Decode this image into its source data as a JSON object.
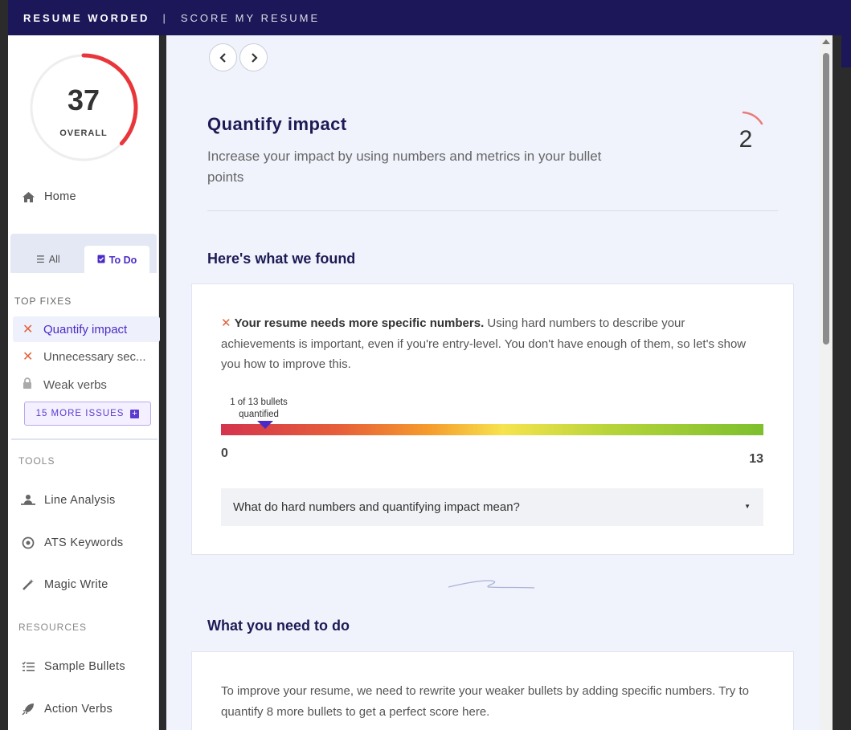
{
  "topbar": {
    "brand": "RESUME WORDED",
    "separator": "|",
    "subtitle": "SCORE MY RESUME"
  },
  "sidebar": {
    "score": {
      "value": "37",
      "label": "OVERALL",
      "fraction": 0.37,
      "arc_color": "#e8363a"
    },
    "home": "Home",
    "tabs": [
      {
        "label": "All",
        "icon": "list-icon"
      },
      {
        "label": "To Do",
        "icon": "clipboard-check-icon"
      }
    ],
    "top_fixes_heading": "TOP FIXES",
    "fixes": [
      {
        "label": "Quantify impact",
        "icon": "x-icon"
      },
      {
        "label": "Unnecessary sec...",
        "icon": "x-icon"
      },
      {
        "label": "Weak verbs",
        "icon": "lock-icon"
      }
    ],
    "more_issues": "15 MORE ISSUES",
    "tools_heading": "TOOLS",
    "tools": [
      {
        "label": "Line Analysis",
        "icon": "person-scan-icon"
      },
      {
        "label": "ATS Keywords",
        "icon": "target-icon"
      },
      {
        "label": "Magic Write",
        "icon": "magic-wand-icon"
      }
    ],
    "resources_heading": "RESOURCES",
    "resources": [
      {
        "label": "Sample Bullets",
        "icon": "list-check-icon"
      },
      {
        "label": "Action Verbs",
        "icon": "rocket-icon"
      }
    ]
  },
  "main": {
    "title": "Quantify impact",
    "description": "Increase your impact by using numbers and metrics in your bullet points",
    "score": "2",
    "found_heading": "Here's what we found",
    "found_bold": "Your resume needs more specific numbers.",
    "found_text": " Using hard numbers to describe your achievements is important, even if you're entry-level. You don't have enough of them, so let's show you how to improve this.",
    "bar": {
      "label": "1 of 13 bullets quantified",
      "min": "0",
      "max": "13",
      "value": 1
    },
    "faq": "What do hard numbers and quantifying impact mean?",
    "todo_heading": "What you need to do",
    "todo_text": "To improve your resume, we need to rewrite your weaker bullets by adding specific numbers. Try to quantify 8 more bullets to get a perfect score here."
  },
  "colors": {
    "brand": "#1b1758",
    "accent": "#4b2bc7",
    "error": "#e2613a",
    "score_arc": "#e8363a"
  }
}
